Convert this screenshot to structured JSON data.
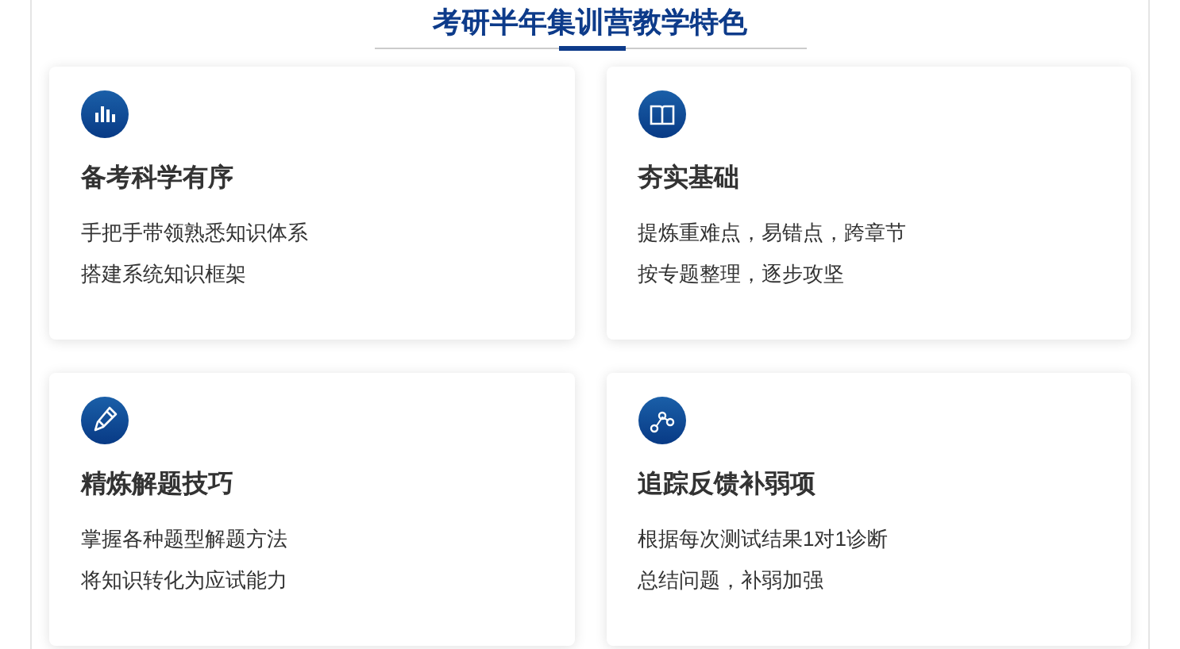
{
  "section_title": "考研半年集训营教学特色",
  "features": [
    {
      "title": "备考科学有序",
      "lines": [
        "手把手带领熟悉知识体系",
        "搭建系统知识框架"
      ]
    },
    {
      "title": "夯实基础",
      "lines": [
        "提炼重难点，易错点，跨章节",
        "按专题整理，逐步攻坚"
      ]
    },
    {
      "title": "精炼解题技巧",
      "lines": [
        "掌握各种题型解题方法",
        "将知识转化为应试能力"
      ]
    },
    {
      "title": "追踪反馈补弱项",
      "lines": [
        "根据每次测试结果1对1诊断",
        "总结问题，补弱加强"
      ]
    }
  ]
}
